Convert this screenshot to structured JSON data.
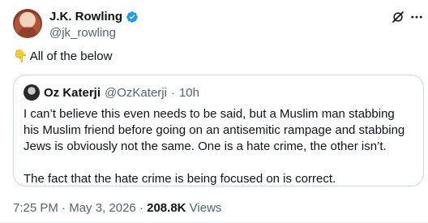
{
  "author": {
    "display_name": "J.K. Rowling",
    "handle": "@jk_rowling"
  },
  "tweet": {
    "emoji": "👇",
    "text": "All of the below"
  },
  "quoted_tweet": {
    "display_name": "Oz Katerji",
    "handle": "@OzKaterji",
    "time_sep": "·",
    "time": "10h",
    "paragraphs": [
      "I can’t believe this even needs to be said, but a Muslim man stabbing his Muslim friend before going on an antisemitic rampage and stabbing Jews is obviously not the same. One is a hate crime, the other isn’t.",
      "The fact that the hate crime is being focused on is correct."
    ]
  },
  "meta": {
    "time": "7:25 PM",
    "sep1": "·",
    "date": "May 3, 2026",
    "sep2": "·",
    "views_count": "208.8K",
    "views_label": "Views"
  },
  "colors": {
    "text": "#0f1419",
    "secondary": "#536471",
    "border": "#cfd9de",
    "verified": "#1d9bf0"
  },
  "icons": [
    "verified-badge-icon",
    "grok-icon",
    "more-icon"
  ]
}
